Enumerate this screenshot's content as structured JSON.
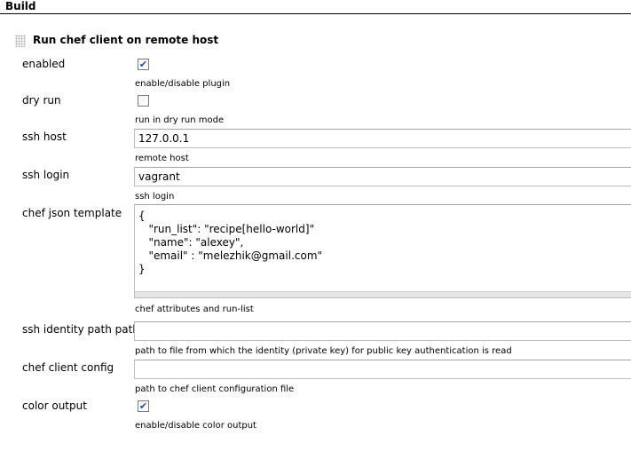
{
  "section": {
    "title": "Build"
  },
  "block": {
    "title": "Run chef client on remote host",
    "drag_icon": "drag-handle-icon"
  },
  "fields": {
    "enabled": {
      "label": "enabled",
      "checked": true,
      "help": "enable/disable plugin"
    },
    "dry_run": {
      "label": "dry run",
      "checked": false,
      "help": "run in dry run mode"
    },
    "ssh_host": {
      "label": "ssh host",
      "value": "127.0.0.1",
      "help": "remote host"
    },
    "ssh_login": {
      "label": "ssh login",
      "value": "vagrant",
      "help": "ssh login"
    },
    "chef_json_template": {
      "label": "chef json template",
      "value": "{\n   \"run_list\": \"recipe[hello-world]\"\n   \"name\": \"alexey\",\n   \"email\" : \"melezhik@gmail.com\"\n}",
      "help": "chef attributes and run-list"
    },
    "ssh_identity_path": {
      "label": "ssh identity path path",
      "value": "",
      "help": "path to file from which the identity (private key) for public key authentication is read"
    },
    "chef_client_config": {
      "label": "chef client config",
      "value": "",
      "help": "path to chef client configuration file"
    },
    "color_output": {
      "label": "color output",
      "checked": true,
      "help": "enable/disable color output"
    }
  },
  "colors": {
    "check_mark": "#1f4fa8",
    "border": "#bcbcbc"
  }
}
